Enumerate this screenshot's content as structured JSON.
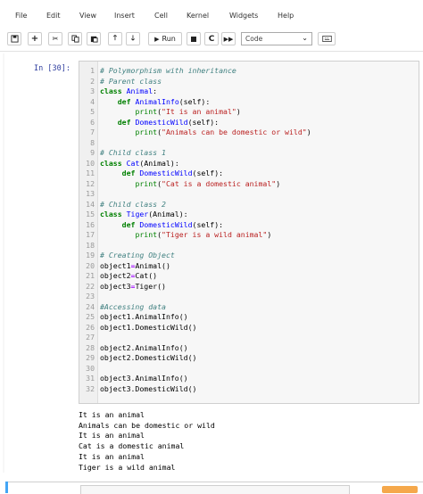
{
  "menu": {
    "items": [
      "File",
      "Edit",
      "View",
      "Insert",
      "Cell",
      "Kernel",
      "Widgets",
      "Help"
    ]
  },
  "toolbar": {
    "run_label": "Run",
    "cell_type": "Code",
    "icons": [
      "save-icon",
      "plus-icon",
      "cut-icon",
      "copy-icon",
      "paste-icon",
      "arrow-up-icon",
      "arrow-down-icon",
      "run-icon",
      "stop-icon",
      "restart-icon",
      "fast-forward-icon",
      "keyboard-icon"
    ]
  },
  "cell": {
    "prompt": "In [30]:",
    "lines": [
      {
        "n": "1",
        "t": "# Polymorphism with inheritance"
      },
      {
        "n": "2",
        "t": "# Parent class"
      },
      {
        "n": "3",
        "t": "class Animal:"
      },
      {
        "n": "4",
        "t": "    def AnimalInfo(self):"
      },
      {
        "n": "5",
        "t": "        print(\"It is an animal\")"
      },
      {
        "n": "6",
        "t": "    def DomesticWild(self):"
      },
      {
        "n": "7",
        "t": "        print(\"Animals can be domestic or wild\")"
      },
      {
        "n": "8",
        "t": ""
      },
      {
        "n": "9",
        "t": "# Child class 1"
      },
      {
        "n": "10",
        "t": "class Cat(Animal):"
      },
      {
        "n": "11",
        "t": "     def DomesticWild(self):"
      },
      {
        "n": "12",
        "t": "        print(\"Cat is a domestic animal\")"
      },
      {
        "n": "13",
        "t": ""
      },
      {
        "n": "14",
        "t": "# Child class 2"
      },
      {
        "n": "15",
        "t": "class Tiger(Animal):"
      },
      {
        "n": "16",
        "t": "     def DomesticWild(self):"
      },
      {
        "n": "17",
        "t": "        print(\"Tiger is a wild animal\")"
      },
      {
        "n": "18",
        "t": ""
      },
      {
        "n": "19",
        "t": "# Creating Object"
      },
      {
        "n": "20",
        "t": "object1=Animal()"
      },
      {
        "n": "21",
        "t": "object2=Cat()"
      },
      {
        "n": "22",
        "t": "object3=Tiger()"
      },
      {
        "n": "23",
        "t": ""
      },
      {
        "n": "24",
        "t": "#Accessing data"
      },
      {
        "n": "25",
        "t": "object1.AnimalInfo()"
      },
      {
        "n": "26",
        "t": "object1.DomesticWild()"
      },
      {
        "n": "27",
        "t": ""
      },
      {
        "n": "28",
        "t": "object2.AnimalInfo()"
      },
      {
        "n": "29",
        "t": "object2.DomesticWild()"
      },
      {
        "n": "30",
        "t": ""
      },
      {
        "n": "31",
        "t": "object3.AnimalInfo()"
      },
      {
        "n": "32",
        "t": "object3.DomesticWild()"
      }
    ],
    "output": [
      "It is an animal",
      "Animals can be domestic or wild",
      "It is an animal",
      "Cat is a domestic animal",
      "It is an animal",
      "Tiger is a wild animal"
    ]
  },
  "colors": {
    "prompt": "#303f9f",
    "comment": "#408080",
    "keyword": "#008000",
    "definition": "#0000ff",
    "string": "#ba2121",
    "operator": "#aa22ff"
  }
}
